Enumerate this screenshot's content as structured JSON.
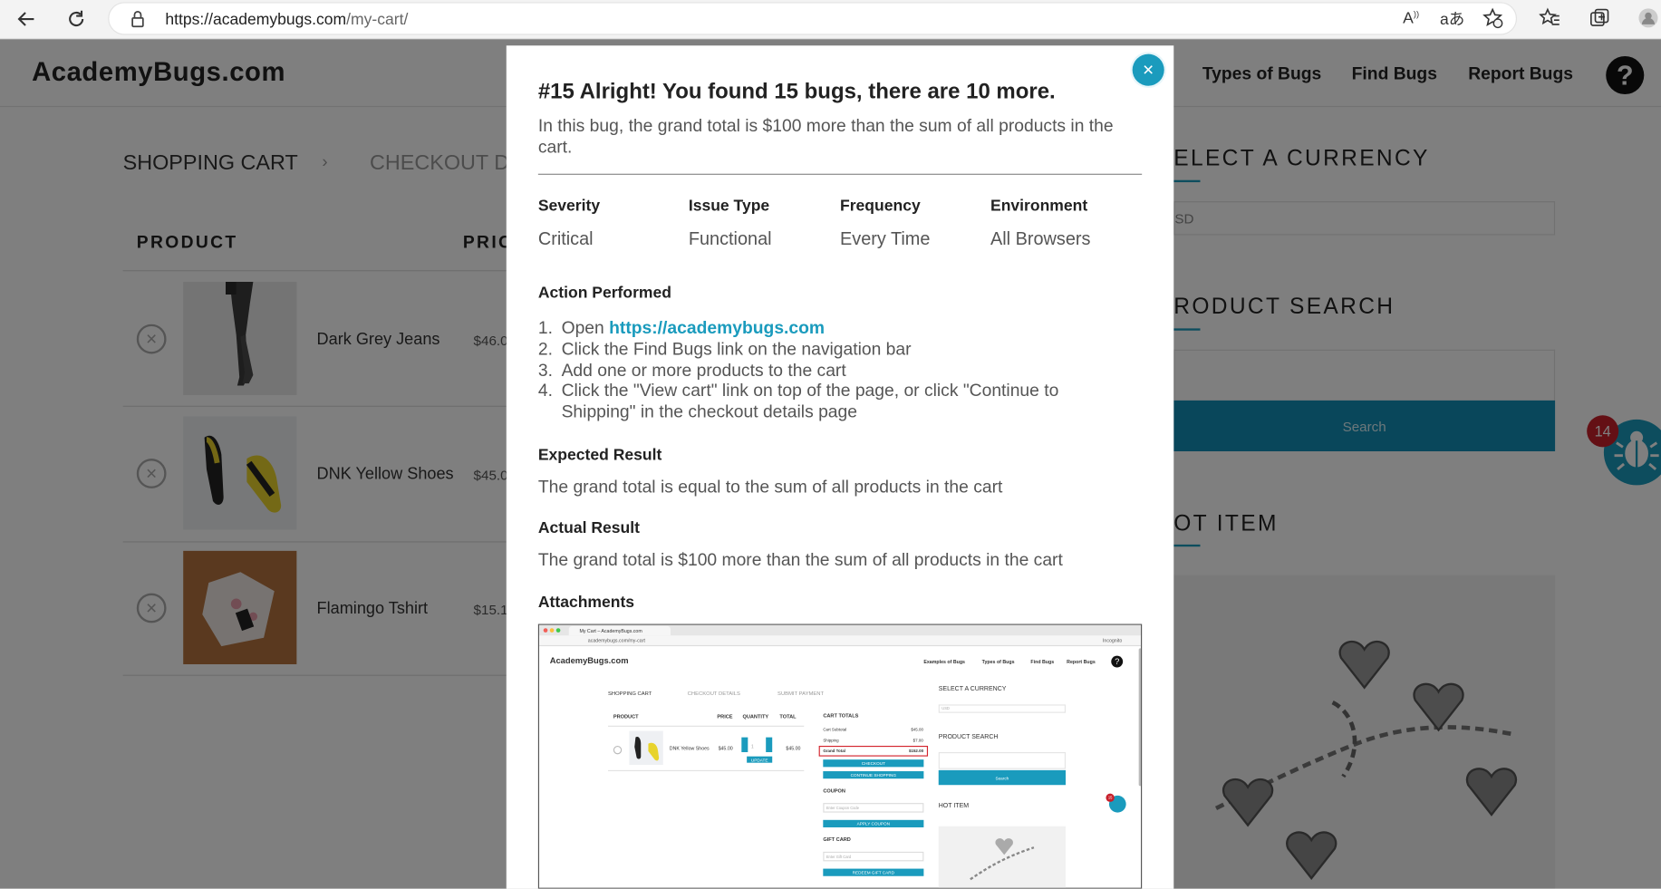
{
  "browser": {
    "url_host": "https://academybugs.com",
    "url_path": "/my-cart/"
  },
  "site": {
    "logo": "AcademyBugs.com",
    "nav": [
      "Types of Bugs",
      "Find Bugs",
      "Report Bugs"
    ],
    "help_symbol": "?",
    "steps": [
      "SHOPPING CART",
      "CHECKOUT D"
    ],
    "step_sep": "›",
    "table_headers": [
      "PRODUCT",
      "PRIC"
    ],
    "products": [
      {
        "name": "Dark Grey Jeans",
        "price": "$46.0"
      },
      {
        "name": "DNK Yellow Shoes",
        "price": "$45.0"
      },
      {
        "name": "Flamingo Tshirt",
        "price": "$15.1"
      }
    ],
    "remove_symbol": "×",
    "sidebar": {
      "currency_heading": "ELECT A CURRENCY",
      "currency_value": "SD",
      "search_heading": "RODUCT SEARCH",
      "search_button": "Search",
      "hot_heading": "OT ITEM"
    },
    "bug_count": "14"
  },
  "modal": {
    "close_symbol": "×",
    "title": "#15 Alright! You found 15 bugs, there are 10 more.",
    "description": "In this bug, the grand total is $100 more than the sum of all products in the cart.",
    "fields": [
      {
        "label": "Severity",
        "value": "Critical"
      },
      {
        "label": "Issue Type",
        "value": "Functional"
      },
      {
        "label": "Frequency",
        "value": "Every Time"
      },
      {
        "label": "Environment",
        "value": "All Browsers"
      }
    ],
    "action_heading": "Action Performed",
    "steps": {
      "s1_prefix": "Open ",
      "s1_link": "https://academybugs.com",
      "s2": "Click the Find Bugs link on the navigation bar",
      "s3": "Add one or more products to the cart",
      "s4": "Click the \"View cart\" link on top of the page, or click \"Continue to Shipping\" in the checkout details page"
    },
    "step_numbers": [
      "1.",
      "2.",
      "3.",
      "4."
    ],
    "expected_heading": "Expected Result",
    "expected_text": "The grand total is equal to the sum of all products in the cart",
    "actual_heading": "Actual Result",
    "actual_text": "The grand total is $100 more than the sum of all products in the cart",
    "attachments_heading": "Attachments"
  },
  "attachment": {
    "tab_title": "My Cart – AcademyBugs.com",
    "url": "academybugs.com/my-cart",
    "incognito": "Incognito",
    "logo": "AcademyBugs.com",
    "nav": [
      "Examples of Bugs",
      "Types of Bugs",
      "Find Bugs",
      "Report Bugs"
    ],
    "steps": [
      "SHOPPING CART",
      "CHECKOUT DETAILS",
      "SUBMIT PAYMENT"
    ],
    "table_headers": [
      "PRODUCT",
      "PRICE",
      "QUANTITY",
      "TOTAL"
    ],
    "product_name": "DNK Yellow Shoes",
    "product_price": "$45.00",
    "product_qty": "1",
    "product_total": "$45.00",
    "update_button": "UPDATE",
    "cart_totals_heading": "CART TOTALS",
    "totals": [
      {
        "label": "Cart Subtotal",
        "value": "$45.00"
      },
      {
        "label": "Shipping",
        "value": "$7.00"
      },
      {
        "label": "Grand Total",
        "value": "$152.00"
      }
    ],
    "checkout_button": "CHECKOUT",
    "continue_button": "CONTINUE SHOPPING",
    "coupon_heading": "COUPON",
    "coupon_placeholder": "Enter Coupon Code",
    "apply_button": "APPLY COUPON",
    "giftcard_heading": "GIFT CARD",
    "giftcard_placeholder": "Enter Gift Card",
    "redeem_button": "REDEEM GIFT CARD",
    "currency_heading": "SELECT A CURRENCY",
    "currency_value": "USD",
    "search_heading": "PRODUCT SEARCH",
    "search_button": "Search",
    "hot_heading": "HOT ITEM",
    "bug_badge": "15"
  },
  "colors": {
    "accent": "#1a9bbd",
    "search_button": "#138eb7",
    "badge_red": "#c8202b",
    "overlay": "rgba(0,0,0,0.5)"
  }
}
